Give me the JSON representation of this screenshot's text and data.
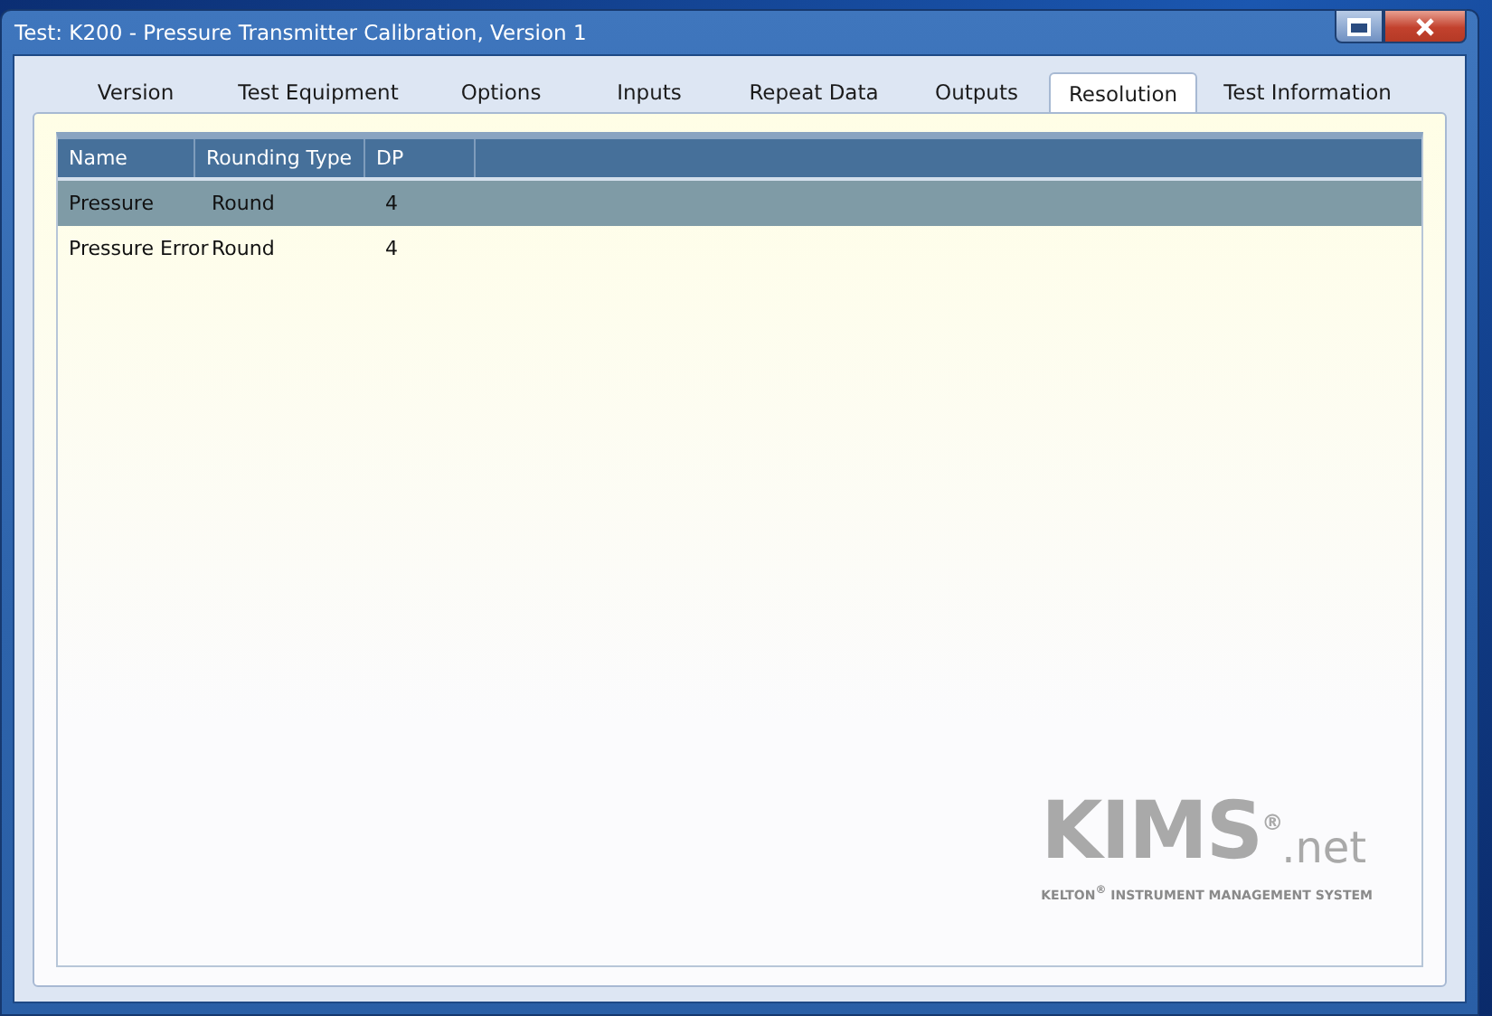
{
  "window": {
    "title": "Test: K200 - Pressure Transmitter Calibration, Version 1"
  },
  "tabs": [
    {
      "label": "Version",
      "selected": false
    },
    {
      "label": "Test Equipment",
      "selected": false
    },
    {
      "label": "Options",
      "selected": false
    },
    {
      "label": "Inputs",
      "selected": false
    },
    {
      "label": "Repeat Data",
      "selected": false
    },
    {
      "label": "Outputs",
      "selected": false
    },
    {
      "label": "Resolution",
      "selected": true
    },
    {
      "label": "Test Information",
      "selected": false
    }
  ],
  "table": {
    "columns": [
      "Name",
      "Rounding Type",
      "DP"
    ],
    "rows": [
      {
        "cells": [
          "Pressure",
          "Round",
          "4"
        ],
        "selected": true
      },
      {
        "cells": [
          "Pressure Error",
          "Round",
          "4"
        ],
        "selected": false
      }
    ]
  },
  "logo": {
    "name": "KIMS$^{®}$",
    "suffix": ".net",
    "tagline": "KELTON$^{®}$ INSTRUMENT MANAGEMENT SYSTEM"
  }
}
